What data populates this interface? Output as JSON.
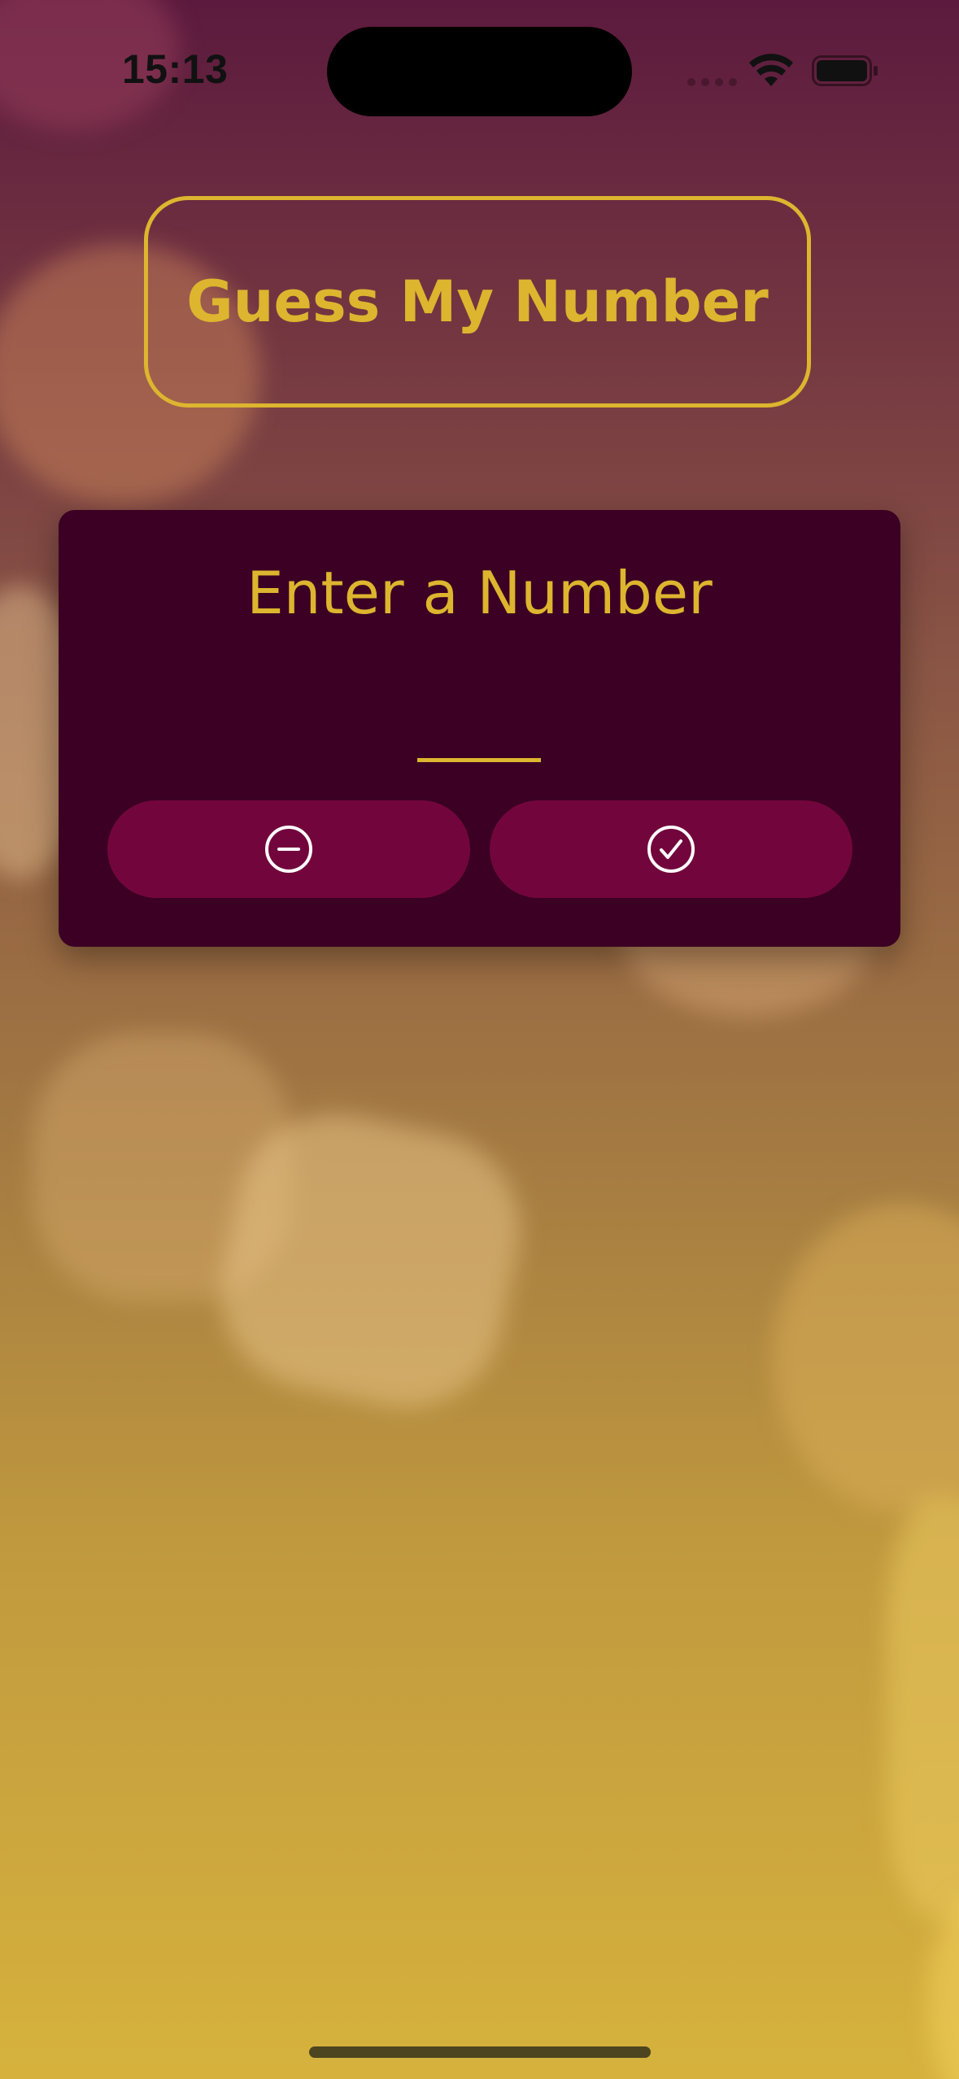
{
  "status_bar": {
    "time": "15:13"
  },
  "title": "Guess My Number",
  "input_card": {
    "label": "Enter a Number",
    "input_value": "",
    "reset_icon": "minus-circle-icon",
    "confirm_icon": "checkmark-circle-icon"
  },
  "colors": {
    "accent": "#ddb52f",
    "card_background": "#3b0023",
    "button_background": "#72063c"
  }
}
